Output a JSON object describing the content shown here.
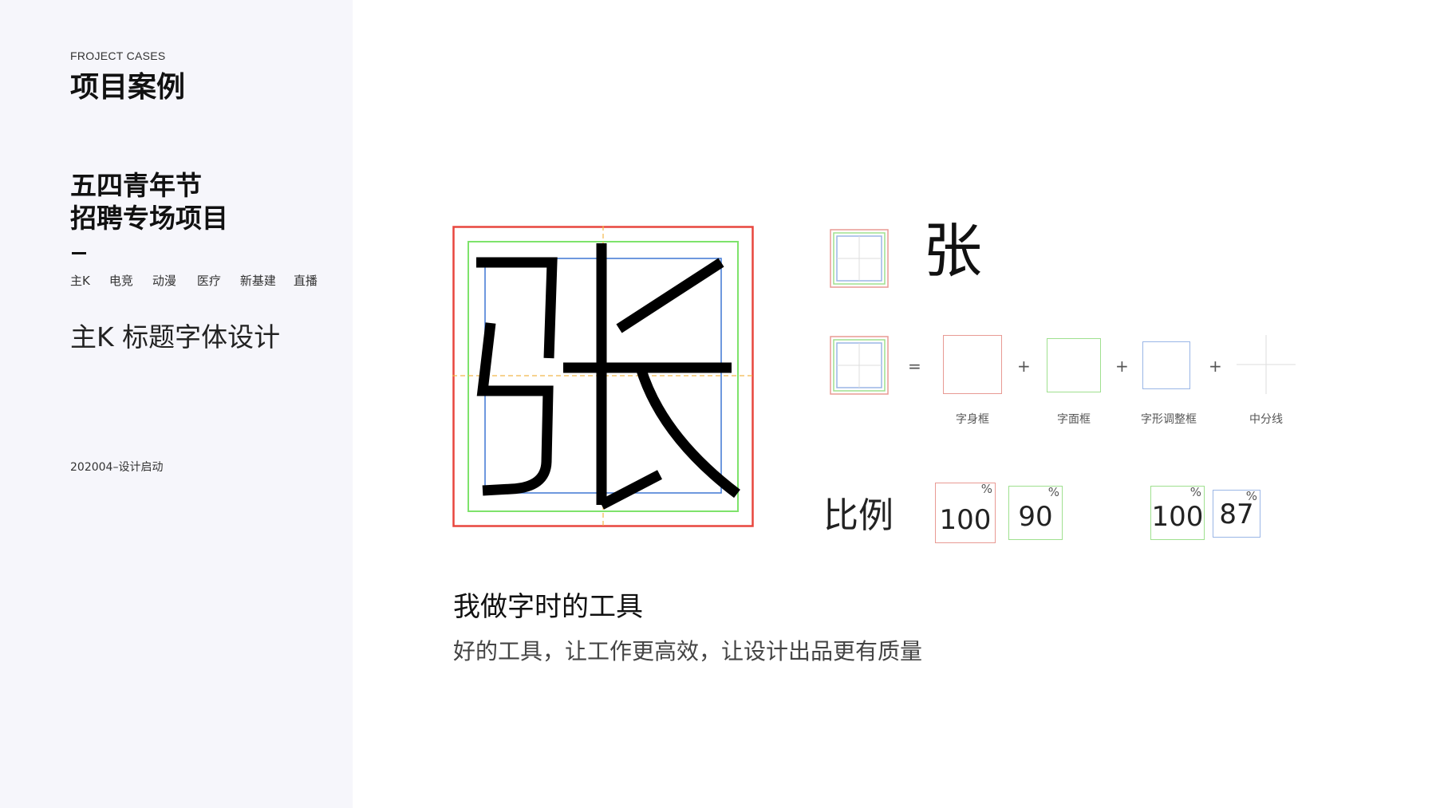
{
  "sidebar": {
    "eyebrow": "FROJECT CASES",
    "section_title": "项目案例",
    "project_title_lines": [
      "五四青年节",
      "招聘专场项目"
    ],
    "dash": "–",
    "tags": [
      "主K",
      "电竞",
      "动漫",
      "医疗",
      "新基建",
      "直播"
    ],
    "design_title": "主K 标题字体设计",
    "date_line": "202004–设计启动"
  },
  "figure": {
    "glyph": "张",
    "frame_colors": {
      "body_frame": "#e8463e",
      "face_frame": "#7ee36b",
      "adjust_frame": "#4a7fd6",
      "center_line": "#f2b84b"
    }
  },
  "legend": {
    "sample_glyph": "张",
    "equals": "=",
    "plus": "+",
    "items": [
      {
        "label": "字身框",
        "color": "#e89a94"
      },
      {
        "label": "字面框",
        "color": "#9fe08f"
      },
      {
        "label": "字形调整框",
        "color": "#9ab6e6"
      },
      {
        "label": "中分线",
        "color": "#dddddd"
      }
    ]
  },
  "ratio": {
    "title": "比例",
    "percent_sign": "%",
    "boxes": [
      {
        "value": "100",
        "color": "#e89a94"
      },
      {
        "value": "90",
        "color": "#9fe08f"
      },
      {
        "value": "100",
        "color": "#9fe08f"
      },
      {
        "value": "87",
        "color": "#9ab6e6"
      }
    ]
  },
  "tools": {
    "title": "我做字时的工具",
    "description": "好的工具，让工作更高效，让设计出品更有质量"
  }
}
